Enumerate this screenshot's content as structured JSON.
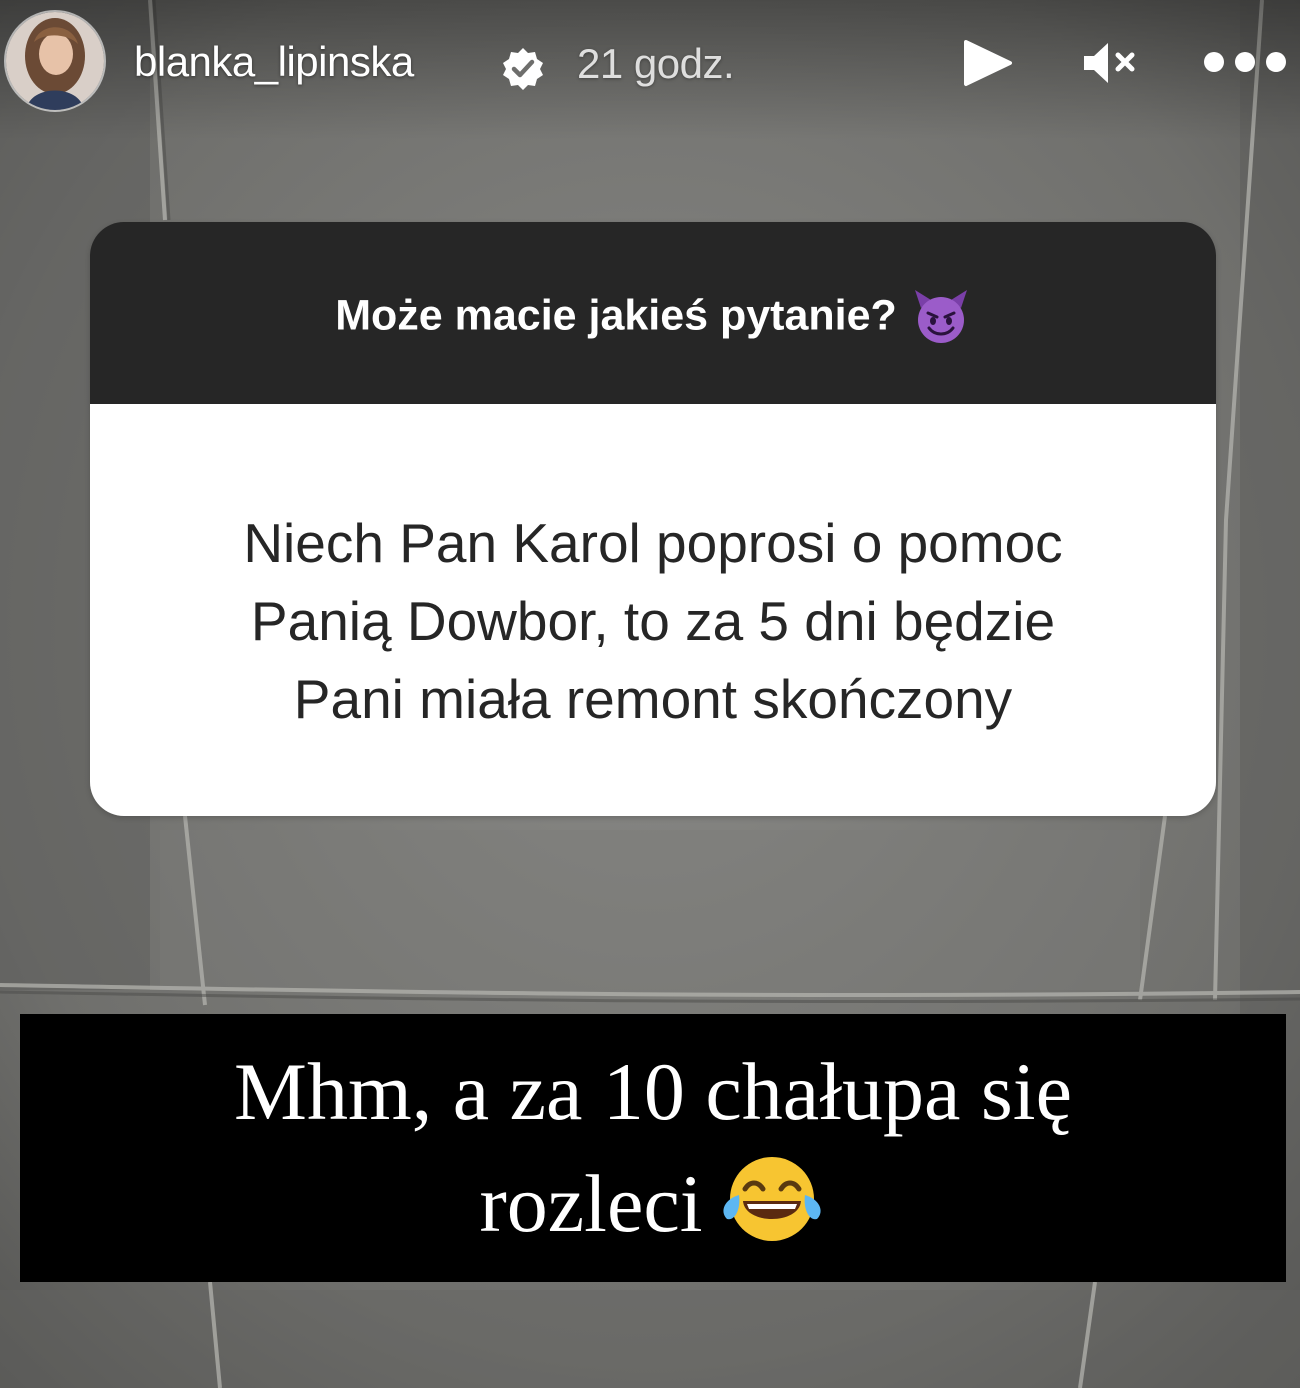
{
  "story": {
    "username": "blanka_lipinska",
    "time_ago": "21 godz.",
    "verified": true,
    "controls": {
      "play_icon": "play-icon",
      "mute_icon": "speaker-muted-icon",
      "more_icon": "more-horizontal-icon"
    }
  },
  "question_sticker": {
    "prompt": "Może macie jakieś pytanie?",
    "prompt_emoji": "smiling-devil-emoji",
    "answer_lines": [
      "Niech Pan Karol poprosi o pomoc",
      "Panią Dowbor, to za 5 dni będzie",
      "Pani miała remont skończony"
    ]
  },
  "caption": {
    "lines": [
      "Mhm, a za 10 chałupa się",
      "rozleci"
    ],
    "emoji": "tears-of-joy-emoji"
  },
  "colors": {
    "sticker_header": "#262626",
    "sticker_body": "#ffffff",
    "caption_background": "#000000",
    "background_tiles": "#6e6e6c"
  }
}
